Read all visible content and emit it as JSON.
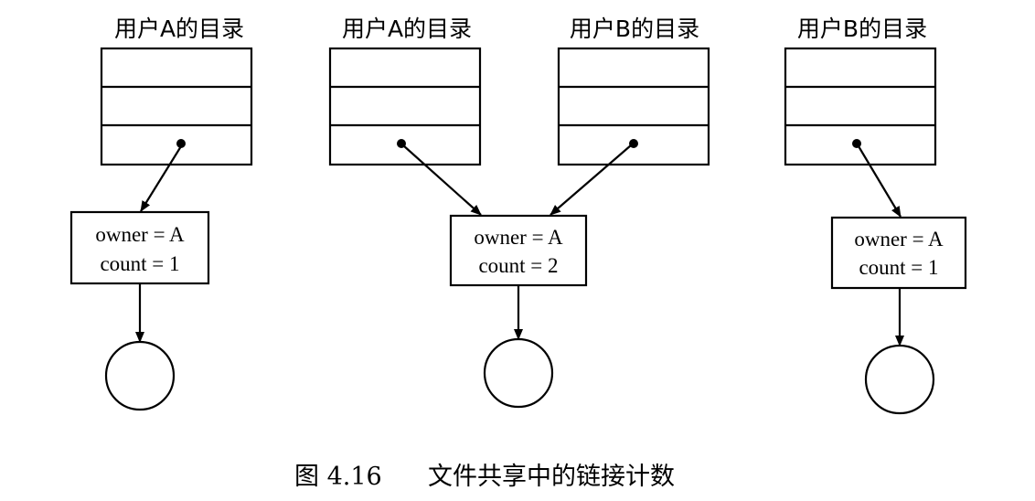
{
  "directories": [
    {
      "title": "用户A的目录"
    },
    {
      "title": "用户A的目录"
    },
    {
      "title": "用户B的目录"
    },
    {
      "title": "用户B的目录"
    }
  ],
  "inodes": [
    {
      "owner": "owner = A",
      "count": "count = 1"
    },
    {
      "owner": "owner = A",
      "count": "count = 2"
    },
    {
      "owner": "owner = A",
      "count": "count = 1"
    }
  ],
  "caption": {
    "figure_number": "图 4.16",
    "text": "文件共享中的链接计数"
  }
}
